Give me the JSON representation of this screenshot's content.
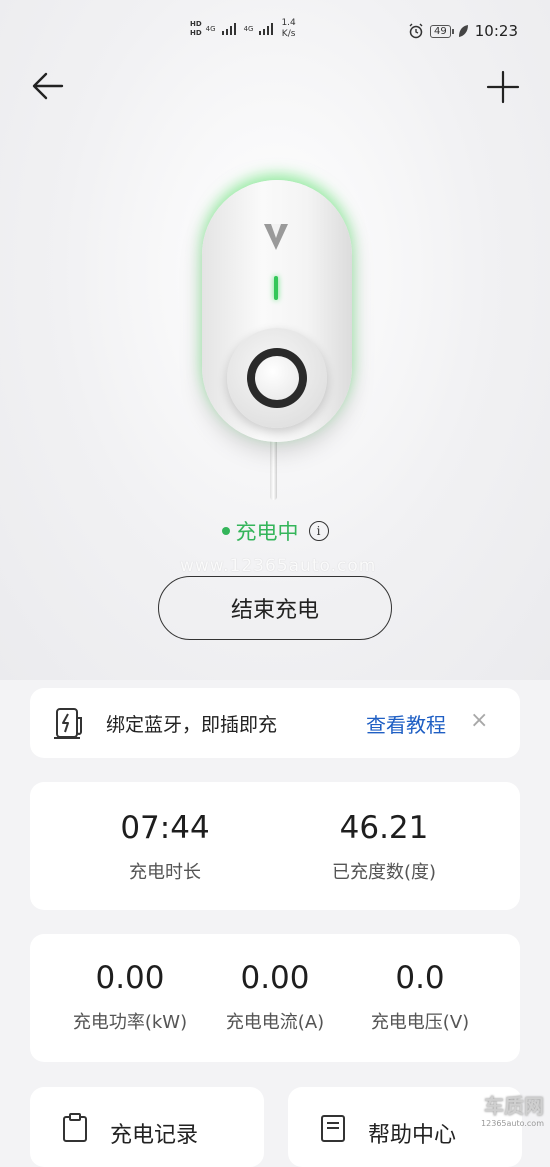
{
  "status_bar": {
    "hd1": "HD",
    "hd2": "HD",
    "net1": "4G",
    "net2": "4G",
    "speed_value": "1.4",
    "speed_unit": "K/s",
    "battery": "49",
    "time": "10:23"
  },
  "charger": {
    "status": "充电中",
    "end_button": "结束充电"
  },
  "watermark": "www.12365auto.com",
  "bluetooth_banner": {
    "text": "绑定蓝牙，即插即充",
    "link": "查看教程",
    "close": "×"
  },
  "stats_primary": [
    {
      "value": "07:44",
      "label": "充电时长"
    },
    {
      "value": "46.21",
      "label": "已充度数(度)"
    }
  ],
  "stats_secondary": [
    {
      "value": "0.00",
      "label": "充电功率(kW)"
    },
    {
      "value": "0.00",
      "label": "充电电流(A)"
    },
    {
      "value": "0.0",
      "label": "充电电压(V)"
    }
  ],
  "bottom_actions": [
    {
      "label": "充电记录"
    },
    {
      "label": "帮助中心"
    }
  ],
  "corner_logo": {
    "big": "车质网",
    "small": "12365auto.com"
  },
  "colors": {
    "charging_green": "#34b55a",
    "link_blue": "#1f5fc4"
  }
}
